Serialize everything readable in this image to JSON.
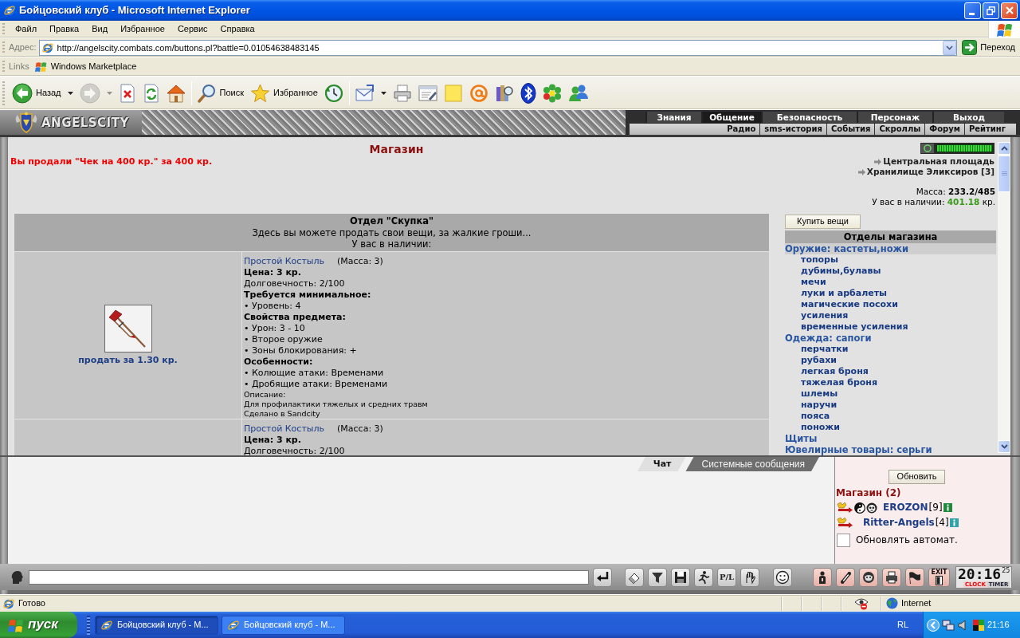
{
  "window": {
    "title": "Бойцовский клуб - Microsoft Internet Explorer"
  },
  "menu": [
    "Файл",
    "Правка",
    "Вид",
    "Избранное",
    "Сервис",
    "Справка"
  ],
  "address_bar": {
    "label": "Адрес:",
    "url": "http://angelscity.combats.com/buttons.pl?battle=0.01054638483145",
    "go_button": "Переход"
  },
  "links_bar": {
    "label": "Links",
    "links": [
      "Windows Marketplace"
    ]
  },
  "toolbar": [
    [
      {
        "kind": "back",
        "label": "Назад",
        "disabled": false,
        "dropdown": true
      },
      {
        "kind": "forward",
        "disabled": true,
        "dropdown": true
      },
      {
        "kind": "stop",
        "disabled": false,
        "dropdown": false
      },
      {
        "kind": "refresh",
        "disabled": false,
        "dropdown": false
      },
      {
        "kind": "home",
        "disabled": false,
        "dropdown": false
      }
    ],
    [
      {
        "kind": "search",
        "label": "Поиск",
        "disabled": false,
        "dropdown": false
      },
      {
        "kind": "favorites",
        "label": "Избранное",
        "disabled": false,
        "dropdown": false
      },
      {
        "kind": "history",
        "disabled": false,
        "dropdown": false
      }
    ],
    [
      {
        "kind": "mail",
        "disabled": false,
        "dropdown": true
      },
      {
        "kind": "print",
        "disabled": false,
        "dropdown": false
      },
      {
        "kind": "edit",
        "disabled": false,
        "dropdown": false
      },
      {
        "kind": "note",
        "disabled": false,
        "dropdown": false
      },
      {
        "kind": "at",
        "disabled": false,
        "dropdown": false
      },
      {
        "kind": "research",
        "disabled": false,
        "dropdown": false
      },
      {
        "kind": "bluetooth",
        "disabled": false,
        "dropdown": false
      },
      {
        "kind": "flower",
        "disabled": false,
        "dropdown": false
      },
      {
        "kind": "messenger",
        "disabled": false,
        "dropdown": false
      }
    ]
  ],
  "game_header": {
    "logo": "ANGELSCITY",
    "nav": [
      {
        "label": "Знания",
        "selected": false
      },
      {
        "label": "Общение",
        "selected": true
      },
      {
        "label": "Безопасность",
        "selected": false
      },
      {
        "label": "Персонаж",
        "selected": false
      },
      {
        "label": "Выход",
        "selected": false
      }
    ],
    "subnav": [
      "Радио",
      "sms-история",
      "События",
      "Скроллы",
      "Форум",
      "Рейтинг"
    ]
  },
  "shop": {
    "title": "Магазин",
    "message": "Вы продали \"Чек на 400 кр.\" за 400 кр.",
    "locations": [
      "Центральная площадь",
      "Хранилище Эликсиров [3]"
    ],
    "mass": "Масса: **233.2/485**",
    "money": "У вас в наличии: **401.18** кр.",
    "department": {
      "title": "Отдел \"Скупка\"",
      "subtitle": "Здесь вы можете продать свои вещи, за жалкие гроши...",
      "caption": "У вас в наличии:"
    },
    "items": [
      {
        "name": "Простой Костыль",
        "mass": "(Масса: 3)",
        "price": "Цена: 3 кр.",
        "durability": "Долговечность: 2/100",
        "sections": [
          {
            "heading": "Требуется минимальное:",
            "lines": [
              "• Уровень: 4"
            ]
          },
          {
            "heading": "Свойства предмета:",
            "lines": [
              "• Урон: 3 - 10",
              "• Второе оружие",
              "• Зоны блокирования: +"
            ]
          },
          {
            "heading": "Особенности:",
            "lines": [
              "• Колющие атаки: Временами",
              "• Дробящие атаки: Временами"
            ]
          }
        ],
        "notes": [
          "Описание:",
          "Для профилактики тяжелых и средних травм",
          "Сделано в Sandcity"
        ],
        "sell": "продать за 1.30 кр."
      },
      {
        "name": "Простой Костыль",
        "mass": "(Масса: 3)",
        "price": "Цена: 3 кр.",
        "durability": "Долговечность: 2/100"
      }
    ],
    "buy_button": "Купить вещи",
    "departments_title": "Отделы магазина",
    "departments": [
      {
        "label": "Оружие: кастеты,ножи",
        "selected": true,
        "children": [
          {
            "label": "топоры",
            "selected": false
          },
          {
            "label": "дубины,булавы",
            "selected": false
          },
          {
            "label": "мечи",
            "selected": false
          },
          {
            "label": "луки и арбалеты",
            "selected": false
          },
          {
            "label": "магические посохи",
            "selected": false
          },
          {
            "label": "усиления",
            "selected": false
          },
          {
            "label": "временные усиления",
            "selected": false
          }
        ]
      },
      {
        "label": "Одежда: сапоги",
        "selected": false,
        "children": [
          {
            "label": "перчатки",
            "selected": false
          },
          {
            "label": "рубахи",
            "selected": false
          },
          {
            "label": "легкая броня",
            "selected": false
          },
          {
            "label": "тяжелая броня",
            "selected": false
          },
          {
            "label": "шлемы",
            "selected": false
          },
          {
            "label": "наручи",
            "selected": false
          },
          {
            "label": "пояса",
            "selected": false
          },
          {
            "label": "поножи",
            "selected": false
          }
        ]
      },
      {
        "label": "Щиты",
        "selected": false
      },
      {
        "label": "Ювелирные товары: серьги",
        "selected": false
      }
    ]
  },
  "chat": {
    "tabs": [
      {
        "label": "Чат",
        "selected": true
      },
      {
        "label": "Системные сообщения",
        "selected": false
      }
    ],
    "refresh_button": "Обновить",
    "room": "Магазин (2)",
    "users": [
      {
        "name": "EROZON",
        "rank": "[9]",
        "emblems": true,
        "color": "#1f8a3c"
      },
      {
        "name": "Ritter-Angels",
        "rank": "[4]",
        "emblems": false,
        "color": "#2fa3a8"
      }
    ],
    "auto_refresh": {
      "label": "Обновлять автомат.",
      "checked": false
    }
  },
  "chat_bar": {
    "translit_button": "P/L",
    "exit_label": "EXIT",
    "clock": {
      "time": "20:16",
      "seconds": "25",
      "modes": [
        {
          "label": "CLOCK",
          "selected": true
        },
        {
          "label": "TIMER",
          "selected": false
        }
      ]
    }
  },
  "status_bar": {
    "text": "Готово",
    "zone": "Internet"
  },
  "taskbar": {
    "start": "пуск",
    "tasks": [
      {
        "label": "Бойцовский клуб - М...",
        "selected": true
      },
      {
        "label": "Бойцовский клуб - М...",
        "selected": false
      }
    ],
    "language": "RL",
    "time": "21:16"
  }
}
